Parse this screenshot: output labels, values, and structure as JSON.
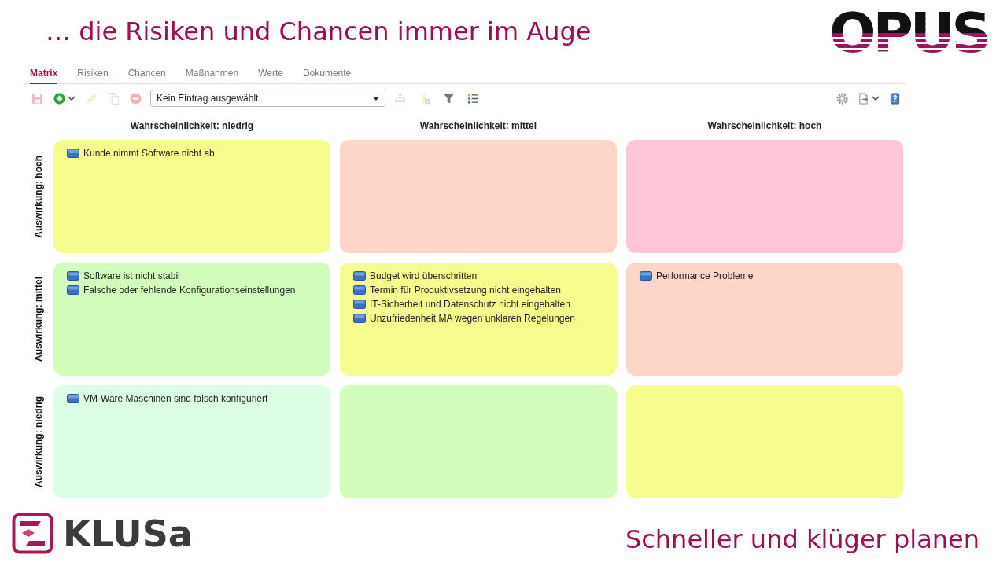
{
  "header": {
    "title": "… die Risiken und Chancen immer im Auge",
    "logo": "OPUS"
  },
  "tabs": [
    {
      "label": "Matrix",
      "selected": true
    },
    {
      "label": "Risiken",
      "selected": false
    },
    {
      "label": "Chancen",
      "selected": false
    },
    {
      "label": "Maßnahmen",
      "selected": false
    },
    {
      "label": "Werte",
      "selected": false
    },
    {
      "label": "Dokumente",
      "selected": false
    }
  ],
  "toolbar": {
    "buttons_before": [
      {
        "kind": "save",
        "disabled": true,
        "menu": false
      },
      {
        "kind": "add",
        "disabled": false,
        "menu": true
      },
      {
        "kind": "edit",
        "disabled": true,
        "menu": false
      },
      {
        "kind": "copy",
        "disabled": true,
        "menu": false
      },
      {
        "kind": "delete",
        "disabled": true,
        "menu": false
      }
    ],
    "selector": {
      "value": "Kein Eintrag ausgewählt"
    },
    "buttons_after": [
      {
        "kind": "hierarchy",
        "disabled": true,
        "menu": false
      },
      {
        "kind": "flash_add",
        "disabled": true,
        "menu": false
      },
      {
        "kind": "filter",
        "disabled": false,
        "menu": false
      },
      {
        "kind": "list",
        "disabled": false,
        "menu": false
      }
    ],
    "buttons_right": [
      {
        "kind": "settings",
        "disabled": false,
        "menu": false
      },
      {
        "kind": "export",
        "disabled": false,
        "menu": true
      },
      {
        "kind": "help",
        "disabled": false,
        "menu": false
      }
    ]
  },
  "matrix": {
    "columns": [
      "Wahrscheinlichkeit: niedrig",
      "Wahrscheinlichkeit: mittel",
      "Wahrscheinlichkeit: hoch"
    ],
    "rows": [
      {
        "label": "Auswirkung: hoch",
        "cells": [
          {
            "color": "#f7fc8f",
            "items": [
              "Kunde nimmt Software nicht ab"
            ]
          },
          {
            "color": "#fed6c7"
          },
          {
            "color": "#ffc5d8"
          }
        ]
      },
      {
        "label": "Auswirkung: mittel",
        "cells": [
          {
            "color": "#d3fdbd",
            "items": [
              "Software ist nicht stabil",
              "Falsche oder fehlende Konfigurationseinstellungen"
            ]
          },
          {
            "color": "#f7fc8f",
            "items": [
              "Budget wird überschritten",
              "Termin für Produktivsetzung nicht eingehalten",
              "IT-Sicherheit und Datenschutz nicht eingehalten",
              "Unzufriedenheit MA wegen unklaren Regelungen"
            ]
          },
          {
            "color": "#fed6c7",
            "items": [
              "Performance Probleme"
            ]
          }
        ]
      },
      {
        "label": "Auswirkung: niedrig",
        "cells": [
          {
            "color": "#dbfee5",
            "items": [
              "VM-Ware Maschinen sind falsch konfiguriert"
            ]
          },
          {
            "color": "#d3fdbd"
          },
          {
            "color": "#f7fc8f"
          }
        ]
      }
    ]
  },
  "footer": {
    "logo": "KLUSa",
    "tagline": "Schneller und klüger planen"
  }
}
